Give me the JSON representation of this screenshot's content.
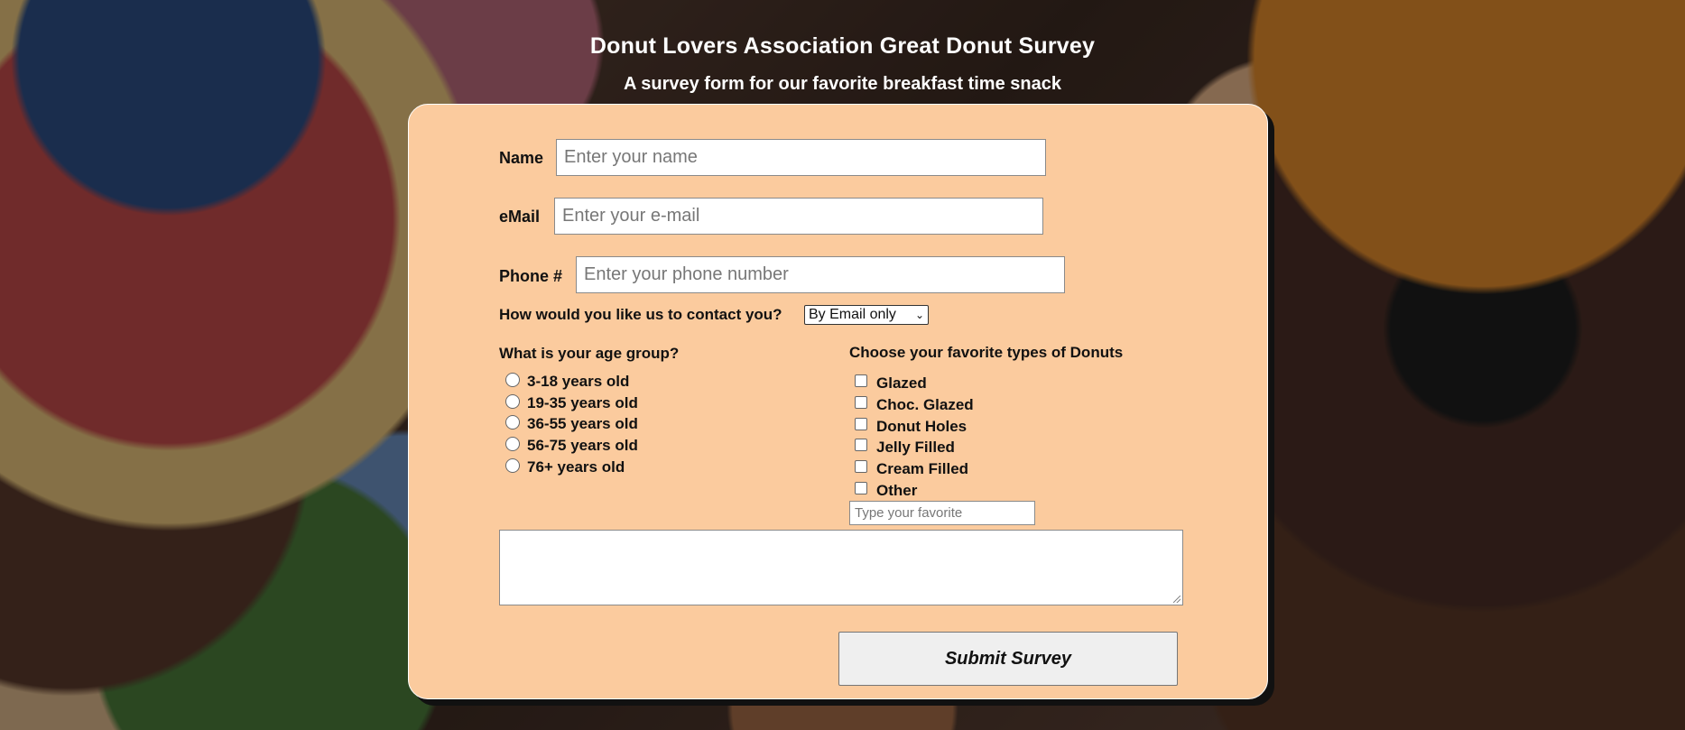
{
  "header": {
    "title": "Donut Lovers Association Great Donut Survey",
    "subtitle": "A survey form for our favorite breakfast time snack"
  },
  "form": {
    "name_label": "Name",
    "name_placeholder": "Enter your name",
    "email_label": "eMail",
    "email_placeholder": "Enter your e-mail",
    "phone_label": "Phone #",
    "phone_placeholder": "Enter your phone number",
    "contact_label": "How would you like us to contact you?",
    "contact_selected": "By Email only",
    "age_title": "What is your age group?",
    "age_options": [
      "3-18 years old",
      "19-35 years old",
      "36-55 years old",
      "56-75 years old",
      "76+ years old"
    ],
    "donut_title": "Choose your favorite types of Donuts",
    "donut_options": [
      "Glazed",
      "Choc. Glazed",
      "Donut Holes",
      "Jelly Filled",
      "Cream Filled",
      "Other"
    ],
    "other_placeholder": "Type your favorite",
    "comments_value": "",
    "submit_label": "Submit Survey"
  },
  "colors": {
    "card_background": "#fbcb9e",
    "title_text": "#ffffff",
    "button_background": "#efefef"
  }
}
